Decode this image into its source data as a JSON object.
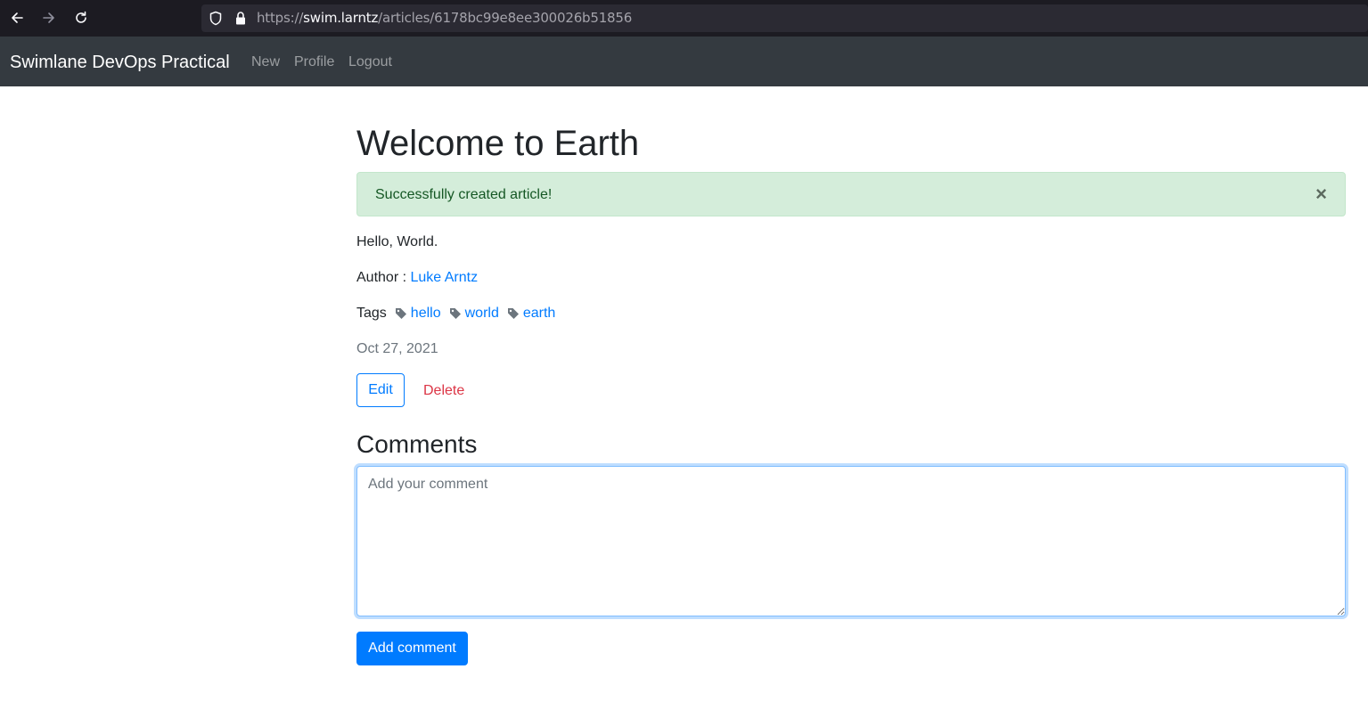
{
  "browser": {
    "url_scheme": "https://",
    "url_host": "swim.larntz",
    "url_path": "/articles/6178bc99e8ee300026b51856",
    "icons": [
      "back-arrow-icon",
      "forward-arrow-icon",
      "reload-icon",
      "shield-icon",
      "lock-icon"
    ]
  },
  "navbar": {
    "brand": "Swimlane DevOps Practical",
    "links": [
      {
        "label": "New"
      },
      {
        "label": "Profile"
      },
      {
        "label": "Logout"
      }
    ]
  },
  "article": {
    "title": "Welcome to Earth",
    "alert": {
      "message": "Successfully created article!",
      "close": "×"
    },
    "body": "Hello, World.",
    "author_label": "Author :",
    "author_name": "Luke Arntz",
    "tags_label": "Tags",
    "tags": [
      {
        "label": "hello",
        "icon": "tag-icon"
      },
      {
        "label": "world",
        "icon": "tag-icon"
      },
      {
        "label": "earth",
        "icon": "tag-icon"
      }
    ],
    "date": "Oct 27, 2021",
    "edit_label": "Edit",
    "delete_label": "Delete"
  },
  "comments": {
    "heading": "Comments",
    "placeholder": "Add your comment",
    "value": "",
    "submit_label": "Add comment"
  },
  "colors": {
    "navbar_bg": "#343a40",
    "link": "#007bff",
    "danger": "#dc3545",
    "success_bg": "#d4edda",
    "success_text": "#155724",
    "muted": "#6c757d"
  }
}
